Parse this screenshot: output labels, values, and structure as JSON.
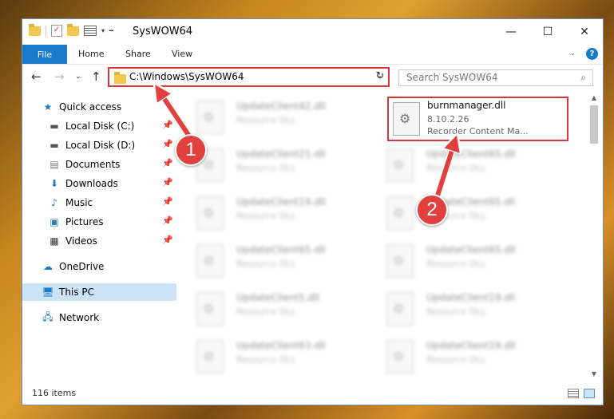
{
  "window": {
    "title": "SysWOW64"
  },
  "ribbon": {
    "tabs": [
      "File",
      "Home",
      "Share",
      "View"
    ],
    "help": "?"
  },
  "address": {
    "path": "C:\\Windows\\SysWOW64"
  },
  "search": {
    "placeholder": "Search SysWOW64"
  },
  "sidebar": {
    "items": [
      {
        "label": "Quick access"
      },
      {
        "label": "Local Disk (C:)"
      },
      {
        "label": "Local Disk (D:)"
      },
      {
        "label": "Documents"
      },
      {
        "label": "Downloads"
      },
      {
        "label": "Music"
      },
      {
        "label": "Pictures"
      },
      {
        "label": "Videos"
      },
      {
        "label": "OneDrive"
      },
      {
        "label": "This PC"
      },
      {
        "label": "Network"
      }
    ]
  },
  "files": {
    "selected": {
      "name": "burnmanager.dll",
      "version": "8.10.2.26",
      "description": "Recorder Content Ma..."
    },
    "items": [
      {
        "name": "UpdateClient42.dll",
        "desc": "Resource DLL"
      },
      {
        "name": "UpdateClient21.dll",
        "desc": "Resource DLL"
      },
      {
        "name": "UpdateClient65.dll",
        "desc": "Resource DLL"
      },
      {
        "name": "UpdateClient19.dll",
        "desc": "Resource DLL"
      },
      {
        "name": "UpdateClient65.dll",
        "desc": "Resource DLL"
      },
      {
        "name": "UpdateClient65.dll",
        "desc": "Resource DLL"
      },
      {
        "name": "UpdateClient65.dll",
        "desc": "Resource DLL"
      },
      {
        "name": "UpdateClient5.dll",
        "desc": "Resource DLL"
      },
      {
        "name": "UpdateClient19.dll",
        "desc": "Resource DLL"
      },
      {
        "name": "UpdateClient63.dll",
        "desc": "Resource DLL"
      },
      {
        "name": "UpdateClient19.dll",
        "desc": "Resource DLL"
      }
    ]
  },
  "status": {
    "count": "116 items"
  },
  "badges": {
    "one": "1",
    "two": "2"
  },
  "colors": {
    "accent": "#1979ca",
    "highlight": "#d9363a",
    "selection": "#cce4f7"
  }
}
